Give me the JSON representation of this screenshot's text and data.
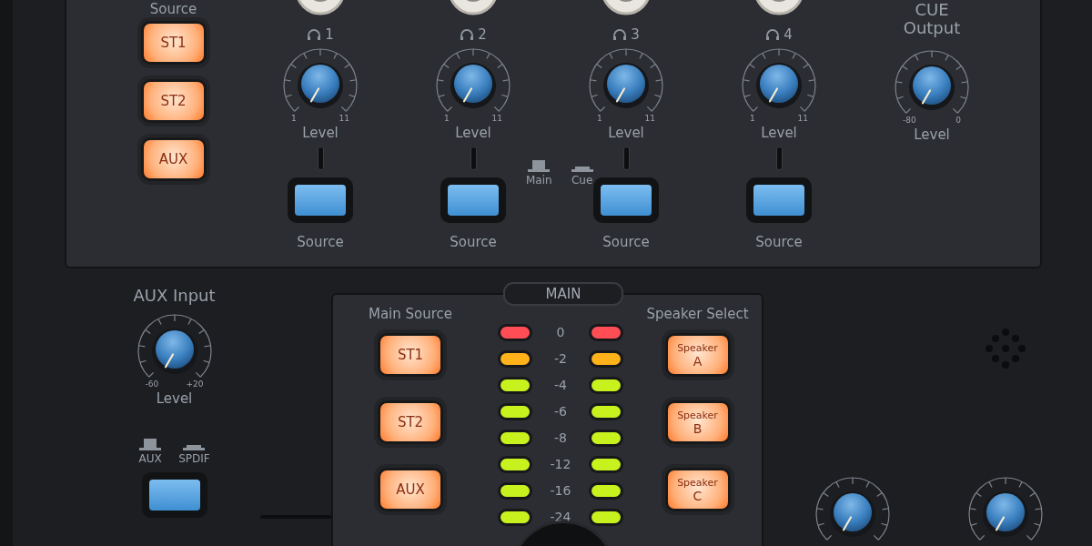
{
  "source_select": {
    "label": "Source",
    "buttons": [
      {
        "label": "ST1",
        "on": true
      },
      {
        "label": "ST2",
        "on": true
      },
      {
        "label": "AUX",
        "on": true
      }
    ]
  },
  "headphones": [
    {
      "number": "1",
      "min": "1",
      "max": "11",
      "level_label": "Level",
      "button_label": "Source"
    },
    {
      "number": "2",
      "min": "1",
      "max": "11",
      "level_label": "Level",
      "button_label": "Source"
    },
    {
      "number": "3",
      "min": "1",
      "max": "11",
      "level_label": "Level",
      "button_label": "Source"
    },
    {
      "number": "4",
      "min": "1",
      "max": "11",
      "level_label": "Level",
      "button_label": "Source"
    }
  ],
  "mode_legend": [
    {
      "label": "Main",
      "pressed": false
    },
    {
      "label": "Cue",
      "pressed": true
    }
  ],
  "cue_output": {
    "title_lines": [
      "CUE",
      "Output"
    ],
    "min": "-80",
    "max": "0",
    "level_label": "Level"
  },
  "aux_input": {
    "title": "AUX Input",
    "min": "-60",
    "max": "+20",
    "level_label": "Level",
    "legend": [
      {
        "label": "AUX",
        "pressed": false
      },
      {
        "label": "SPDIF",
        "pressed": true
      }
    ]
  },
  "main": {
    "title": "MAIN",
    "source_label": "Main Source",
    "sources": [
      {
        "label": "ST1",
        "on": true
      },
      {
        "label": "ST2",
        "on": true
      },
      {
        "label": "AUX",
        "on": true
      }
    ],
    "meter": [
      {
        "label": "0",
        "color": "#ff4d55"
      },
      {
        "label": "-2",
        "color": "#ffb21a"
      },
      {
        "label": "-4",
        "color": "#c8f21e"
      },
      {
        "label": "-6",
        "color": "#c8f21e"
      },
      {
        "label": "-8",
        "color": "#c8f21e"
      },
      {
        "label": "-12",
        "color": "#c8f21e"
      },
      {
        "label": "-16",
        "color": "#c8f21e"
      },
      {
        "label": "-24",
        "color": "#c8f21e"
      }
    ],
    "speaker_label": "Speaker Select",
    "speakers": [
      {
        "line1": "Speaker",
        "line2": "A",
        "on": true
      },
      {
        "line1": "Speaker",
        "line2": "B",
        "on": true
      },
      {
        "line1": "Speaker",
        "line2": "C",
        "on": true
      }
    ]
  }
}
